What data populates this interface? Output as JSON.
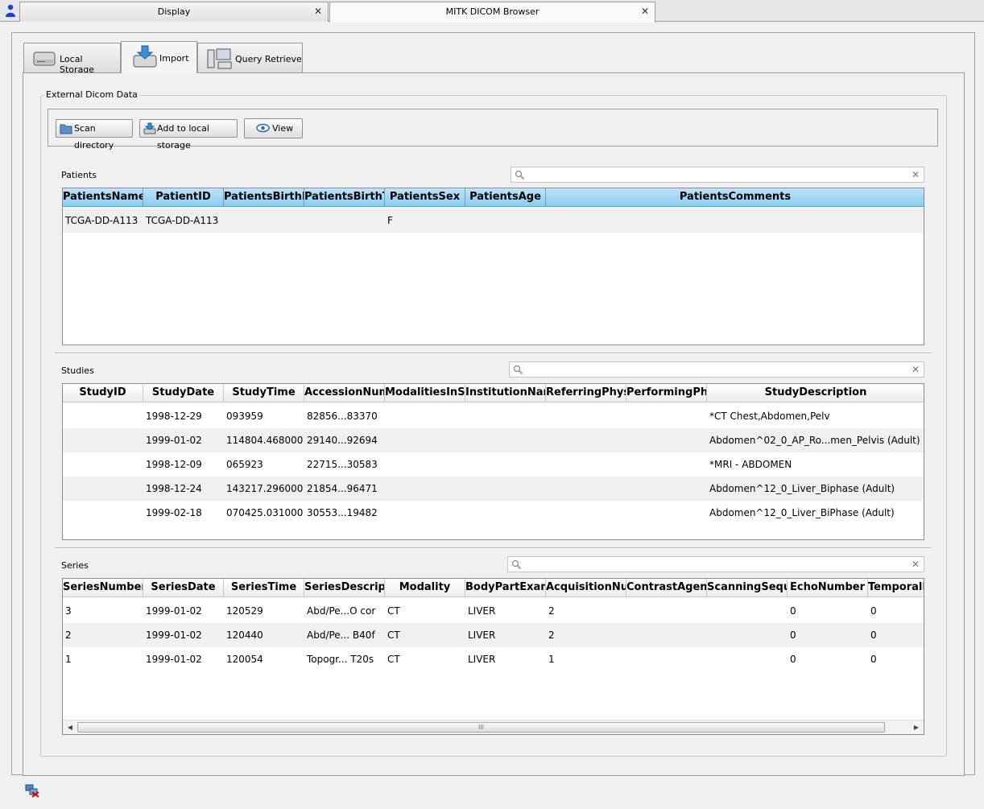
{
  "editor_tabs": [
    {
      "label": "Display"
    },
    {
      "label": "MITK DICOM Browser"
    }
  ],
  "main_tabs": {
    "local_storage": "Local Storage",
    "import": "Import",
    "query_retrieve": "Query Retrieve"
  },
  "group_title": "External Dicom Data",
  "toolbar": {
    "scan_directory": "Scan directory",
    "add_to_local_storage": "Add to local storage",
    "view": "View"
  },
  "patients": {
    "label": "Patients",
    "search_value": "",
    "columns": [
      "PatientsName",
      "PatientID",
      "PatientsBirthDate",
      "PatientsBirthTime",
      "PatientsSex",
      "PatientsAge",
      "PatientsComments"
    ],
    "rows": [
      [
        "TCGA-DD-A113",
        "TCGA-DD-A113",
        "",
        "",
        "F",
        "",
        ""
      ]
    ]
  },
  "studies": {
    "label": "Studies",
    "search_value": "",
    "columns": [
      "StudyID",
      "StudyDate",
      "StudyTime",
      "AccessionNumber",
      "ModalitiesInStudy",
      "InstitutionName",
      "ReferringPhysician",
      "PerformingPhysicians",
      "StudyDescription"
    ],
    "rows": [
      [
        "",
        "1998-12-29",
        "093959",
        "82856...83370",
        "",
        "",
        "",
        "",
        "*CT Chest,Abdomen,Pelv"
      ],
      [
        "",
        "1999-01-02",
        "114804.468000",
        "29140...92694",
        "",
        "",
        "",
        "",
        "Abdomen^02_0_AP_Ro...men_Pelvis (Adult)"
      ],
      [
        "",
        "1998-12-09",
        "065923",
        "22715...30583",
        "",
        "",
        "",
        "",
        "*MRI - ABDOMEN"
      ],
      [
        "",
        "1998-12-24",
        "143217.296000",
        "21854...96471",
        "",
        "",
        "",
        "",
        "Abdomen^12_0_Liver_Biphase (Adult)"
      ],
      [
        "",
        "1999-02-18",
        "070425.031000",
        "30553...19482",
        "",
        "",
        "",
        "",
        "Abdomen^12_0_Liver_BiPhase (Adult)"
      ]
    ]
  },
  "series": {
    "label": "Series",
    "search_value": "",
    "columns": [
      "SeriesNumber",
      "SeriesDate",
      "SeriesTime",
      "SeriesDescription",
      "Modality",
      "BodyPartExamined",
      "AcquisitionNumber",
      "ContrastAgent",
      "ScanningSequence",
      "EchoNumber",
      "TemporalPosition"
    ],
    "rows": [
      [
        "3",
        "1999-01-02",
        "120529",
        "Abd/Pe...O  cor",
        "CT",
        "LIVER",
        "2",
        "",
        "",
        "0",
        "0"
      ],
      [
        "2",
        "1999-01-02",
        "120440",
        "Abd/Pe...  B40f",
        "CT",
        "LIVER",
        "2",
        "",
        "",
        "0",
        "0"
      ],
      [
        "1",
        "1999-01-02",
        "120054",
        "Topogr...  T20s",
        "CT",
        "LIVER",
        "1",
        "",
        "",
        "0",
        "0"
      ]
    ]
  },
  "scrollbar_grip": "III"
}
